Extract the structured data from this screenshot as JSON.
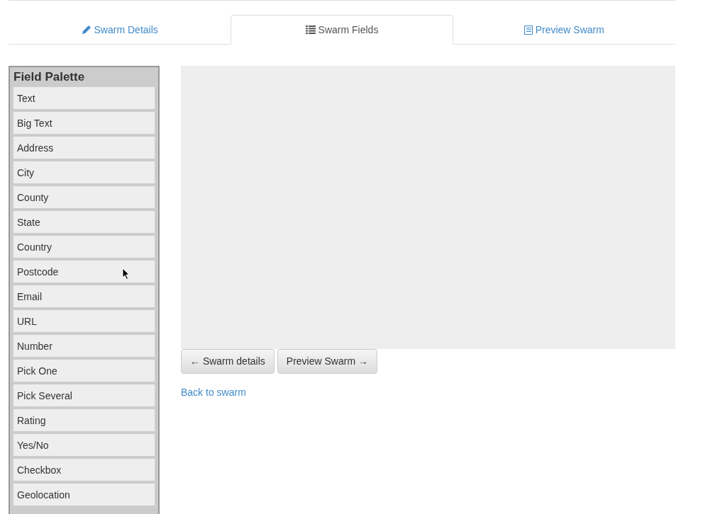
{
  "tabs": [
    {
      "label": "Swarm Details",
      "kind": "pencil",
      "selected": false
    },
    {
      "label": "Swarm Fields",
      "kind": "list",
      "selected": true
    },
    {
      "label": "Preview Swarm",
      "kind": "form",
      "selected": false
    }
  ],
  "palette": {
    "title": "Field Palette",
    "items": [
      "Text",
      "Big Text",
      "Address",
      "City",
      "County",
      "State",
      "Country",
      "Postcode",
      "Email",
      "URL",
      "Number",
      "Pick One",
      "Pick Several",
      "Rating",
      "Yes/No",
      "Checkbox",
      "Geolocation"
    ]
  },
  "buttons": [
    "← Swarm details",
    "Preview Swarm →"
  ],
  "back_link": "Back to swarm"
}
